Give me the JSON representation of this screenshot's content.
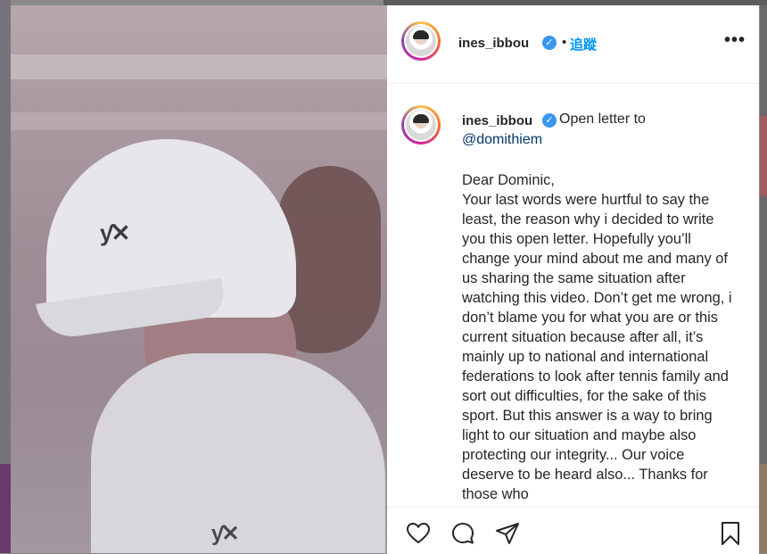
{
  "post": {
    "username": "ines_ibbou",
    "follow_label": "追蹤",
    "separator": "•",
    "more_label": "•••"
  },
  "comment": {
    "username": "ines_ibbou",
    "heading": "Open letter to",
    "mention": "@domithiem",
    "caption": "Dear Dominic,\nYour last words were hurtful to say the least, the reason why i decided to write you this open letter. Hopefully you’ll change your mind about me and many of us sharing the same situation after watching this video. Don’t get me wrong, i don’t blame you for what you are or this current situation because after all, it’s mainly up to national and international federations to look after tennis family and sort out difficulties, for the sake of this sport. But this answer is a way to bring light to our situation and maybe also protecting our integrity... Our voice deserve to be heard also... Thanks for those who"
  },
  "icons": {
    "verified": "check-badge-icon",
    "like": "heart-icon",
    "comment": "speech-bubble-icon",
    "share": "paper-plane-icon",
    "save": "bookmark-icon"
  },
  "colors": {
    "link": "#0095f6",
    "verified": "#3897f0",
    "mention": "#00376b",
    "text": "#262626"
  }
}
